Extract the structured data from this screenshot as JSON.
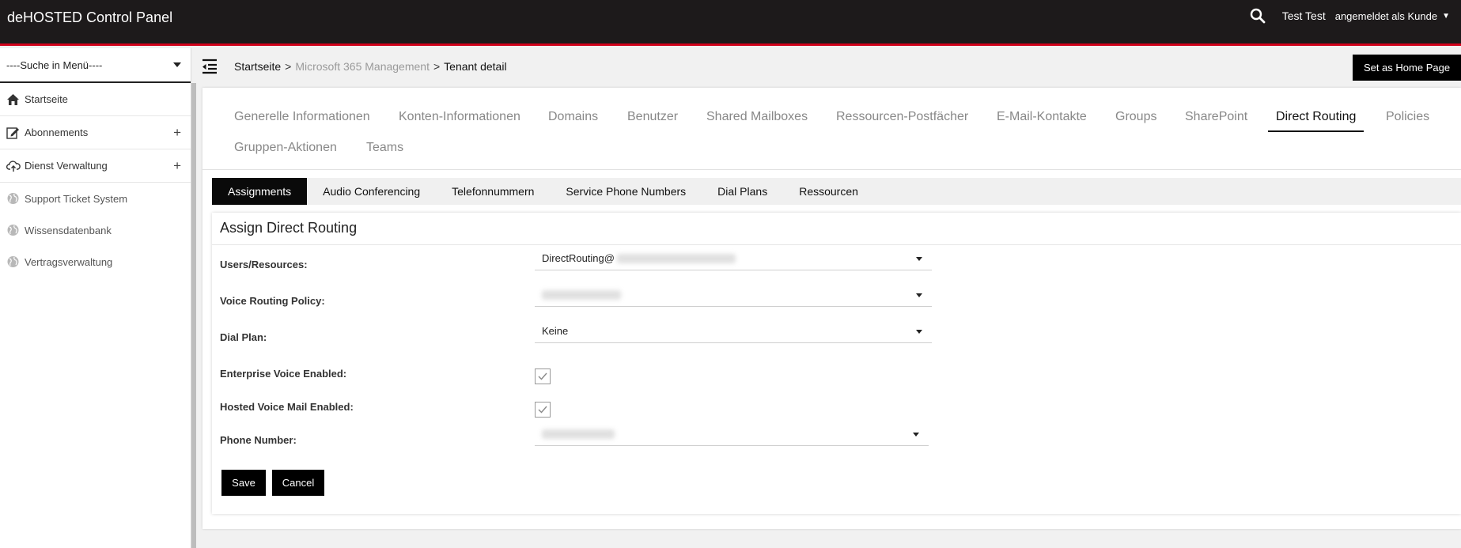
{
  "app": {
    "title": "deHOSTED Control Panel",
    "user_name": "Test Test",
    "role_label": "angemeldet als Kunde"
  },
  "sidebar": {
    "search_label": "----Suche in Menü----",
    "items": [
      {
        "label": "Startseite",
        "icon": "home-icon"
      },
      {
        "label": "Abonnements",
        "icon": "edit-icon",
        "expandable": true
      },
      {
        "label": "Dienst Verwaltung",
        "icon": "cloud-upload-icon",
        "expandable": true
      },
      {
        "label": "Support Ticket System",
        "icon": "globe-icon"
      },
      {
        "label": "Wissensdatenbank",
        "icon": "globe-icon"
      },
      {
        "label": "Vertragsverwaltung",
        "icon": "globe-icon"
      }
    ]
  },
  "breadcrumb": {
    "home": "Startseite",
    "separator": ">",
    "middle": "Microsoft 365 Management",
    "current": "Tenant detail"
  },
  "home_button": "Set as Home Page",
  "main_tabs": [
    "Generelle Informationen",
    "Konten-Informationen",
    "Domains",
    "Benutzer",
    "Shared Mailboxes",
    "Ressourcen-Postfächer",
    "E-Mail-Kontakte",
    "Groups",
    "SharePoint",
    "Direct Routing",
    "Policies",
    "Gruppen-Aktionen",
    "Teams"
  ],
  "active_main_tab": "Direct Routing",
  "sub_tabs": [
    "Assignments",
    "Audio Conferencing",
    "Telefonnummern",
    "Service Phone Numbers",
    "Dial Plans",
    "Ressourcen"
  ],
  "active_sub_tab": "Assignments",
  "form": {
    "title": "Assign Direct Routing",
    "users_label": "Users/Resources:",
    "users_value": "DirectRouting@",
    "voice_policy_label": "Voice Routing Policy:",
    "dial_plan_label": "Dial Plan:",
    "dial_plan_value": "Keine",
    "enterprise_voice_label": "Enterprise Voice Enabled:",
    "enterprise_voice_checked": true,
    "hosted_voicemail_label": "Hosted Voice Mail Enabled:",
    "hosted_voicemail_checked": true,
    "phone_number_label": "Phone Number:",
    "save_label": "Save",
    "cancel_label": "Cancel"
  }
}
